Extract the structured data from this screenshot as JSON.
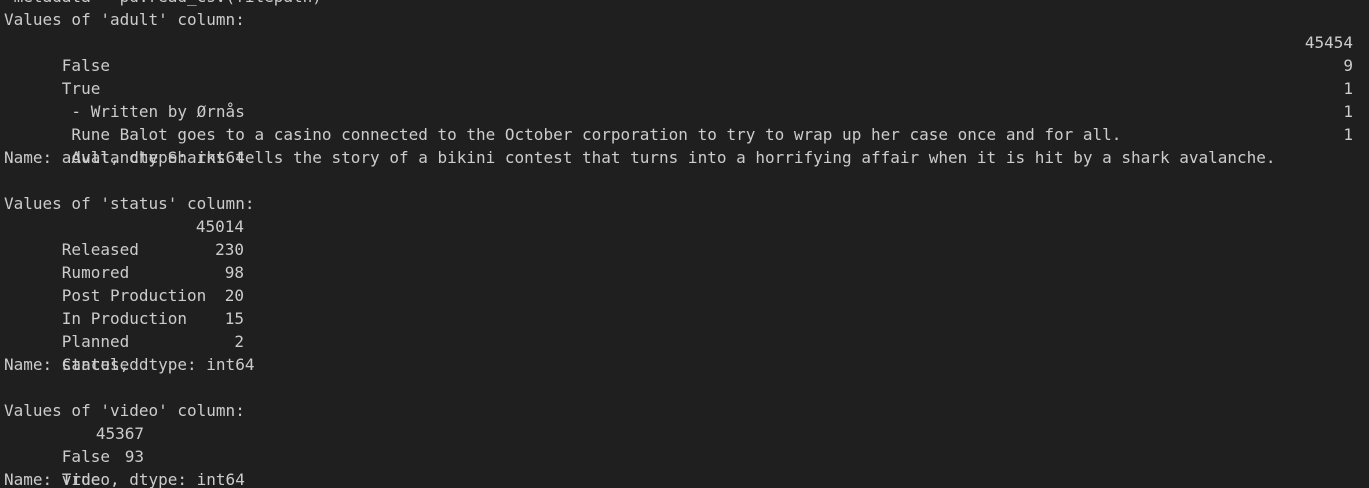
{
  "terminal": {
    "top_line": " metadata = pd.read_csv(filepath)",
    "adult": {
      "header": "Values of 'adult' column:",
      "rows": [
        {
          "label": "False",
          "count": "45454"
        },
        {
          "label": "True",
          "count": "9"
        },
        {
          "label": " - Written by Ørnås",
          "count": "1"
        },
        {
          "label": " Rune Balot goes to a casino connected to the October corporation to try to wrap up her case once and for all.",
          "count": "1"
        },
        {
          "label": " Avalanche Sharks tells the story of a bikini contest that turns into a horrifying affair when it is hit by a shark avalanche.",
          "count": "1"
        }
      ],
      "footer": "Name: adult, dtype: int64"
    },
    "status": {
      "header": "Values of 'status' column:",
      "rows": [
        {
          "label": "Released",
          "count": "45014"
        },
        {
          "label": "Rumored",
          "count": "230"
        },
        {
          "label": "Post Production",
          "count": "98"
        },
        {
          "label": "In Production",
          "count": "20"
        },
        {
          "label": "Planned",
          "count": "15"
        },
        {
          "label": "Canceled",
          "count": "2"
        }
      ],
      "footer": "Name: status, dtype: int64"
    },
    "video": {
      "header": "Values of 'video' column:",
      "rows": [
        {
          "label": "False",
          "count": "45367"
        },
        {
          "label": "True",
          "count": "93"
        }
      ],
      "footer": "Name: video, dtype: int64"
    }
  }
}
